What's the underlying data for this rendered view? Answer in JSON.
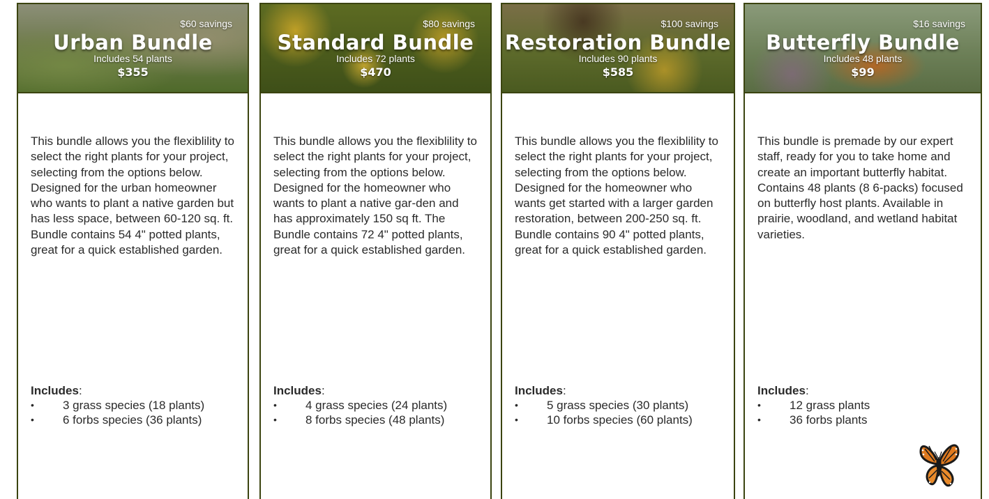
{
  "cards": [
    {
      "savings": "$60 savings",
      "title": "Urban Bundle",
      "includes_count": "Includes 54 plants",
      "price": "$355",
      "description": "This bundle allows you the flexiblility to select the right plants for your project, selecting from the options below. Designed for the urban homeowner who wants to plant a native garden but has less space, between 60-120 sq. ft. Bundle contains 54 4\" potted plants, great for a quick established garden.",
      "includes_label": "Includes",
      "items": [
        "3 grass species (18 plants)",
        "6 forbs species (36 plants)"
      ]
    },
    {
      "savings": "$80 savings",
      "title": "Standard Bundle",
      "includes_count": "Includes 72 plants",
      "price": "$470",
      "description": "This bundle allows you the flexiblility to select the right plants for your project, selecting from the options below. Designed for the homeowner who wants to plant a native gar-den and has approximately 150 sq ft. The Bundle contains 72 4\" potted plants, great for a quick established garden.",
      "includes_label": "Includes",
      "items": [
        "4 grass species (24 plants)",
        "8 forbs species (48 plants)"
      ]
    },
    {
      "savings": "$100 savings",
      "title": "Restoration Bundle",
      "includes_count": "Includes 90 plants",
      "price": "$585",
      "description": "This bundle allows you the flexiblility to select the right plants for your project, selecting from the options below. Designed for the homeowner who wants get started with a larger garden restoration, between 200-250 sq. ft. Bundle contains 90 4\" potted plants, great for a quick established garden.",
      "includes_label": "Includes",
      "items": [
        "5 grass species (30 plants)",
        "10 forbs species (60 plants)"
      ]
    },
    {
      "savings": "$16 savings",
      "title": "Butterfly Bundle",
      "includes_count": "Includes 48 plants",
      "price": "$99",
      "description": "This bundle is premade by our expert staff, ready for you to take home and create an important butterfly habitat. Contains 48 plants (8 6-packs) focused on butterfly host plants. Available in prairie, woodland, and wetland habitat varieties.",
      "includes_label": "Includes",
      "items": [
        "12 grass plants",
        "36 forbs plants"
      ]
    }
  ],
  "bullet_char": "•",
  "colors": {
    "border": "#3b4410",
    "text": "#2a2a2a",
    "banner_text": "#ffffff"
  },
  "icons": {
    "decoration": "monarch-butterfly-icon"
  }
}
